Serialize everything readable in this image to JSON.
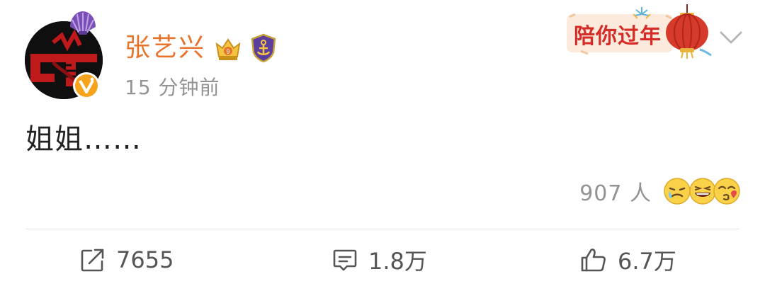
{
  "post": {
    "author": {
      "name": "张艺兴",
      "badges": [
        "vip-crown-icon",
        "anchor-shield-icon"
      ],
      "verified": true,
      "avatar_text": "LT"
    },
    "timestamp": "15 分钟前",
    "sticker": {
      "text": "陪你过年"
    },
    "content": "姐姐……",
    "reactions": {
      "count_text": "907 人",
      "emojis": [
        "tears-laugh-emoji-icon",
        "grin-emoji-icon",
        "kiss-emoji-icon"
      ]
    },
    "actions": {
      "repost": "7655",
      "comment": "1.8万",
      "like": "6.7万"
    }
  },
  "colors": {
    "username": "#E8732A",
    "secondary_text": "#939393",
    "body_text": "#222222",
    "action_text": "#555555",
    "verified_badge": "#F7A31C",
    "sticker_red": "#D52C28"
  }
}
